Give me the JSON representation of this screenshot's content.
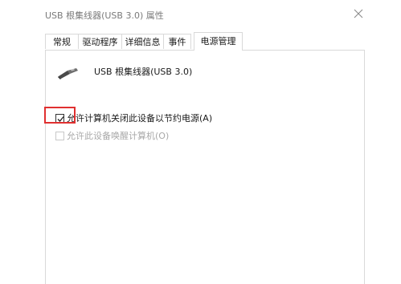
{
  "window": {
    "title": "USB 根集线器(USB 3.0) 属性"
  },
  "tabs": [
    {
      "label": "常规",
      "active": false
    },
    {
      "label": "驱动程序",
      "active": false
    },
    {
      "label": "详细信息",
      "active": false
    },
    {
      "label": "事件",
      "active": false
    },
    {
      "label": "电源管理",
      "active": true
    }
  ],
  "device": {
    "icon": "usb-plug-icon",
    "name": "USB 根集线器(USB 3.0)"
  },
  "power_options": [
    {
      "label": "允许计算机关闭此设备以节约电源(A)",
      "checked": true,
      "enabled": true
    },
    {
      "label": "允许此设备唤醒计算机(O)",
      "checked": false,
      "enabled": false
    }
  ],
  "colors": {
    "highlight": "#e03030",
    "title_text": "#7a7a7a",
    "disabled_text": "#a8a8a8",
    "border": "#d9d9d9"
  }
}
